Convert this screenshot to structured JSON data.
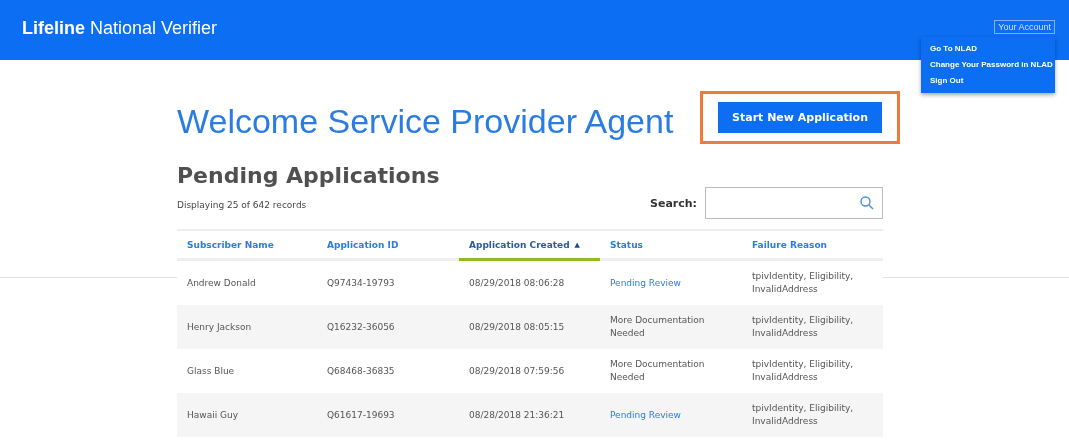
{
  "header": {
    "title": "**Lifeline** National Verifier",
    "account_button": "Your Account"
  },
  "account_menu": {
    "items": [
      {
        "label": "Go To NLAD"
      },
      {
        "label": "Change Your Password in NLAD"
      },
      {
        "label": "Sign Out"
      }
    ]
  },
  "welcome": "Welcome Service Provider Agent",
  "start_button": {
    "label": "Start New Application",
    "highlighted": true
  },
  "pending": {
    "title": "Pending Applications",
    "count_text": "Displaying 25 of 642 records",
    "search_label": "Search:"
  },
  "table": {
    "columns": [
      {
        "label": "Subscriber Name",
        "selected": false
      },
      {
        "label": "Application ID",
        "selected": false
      },
      {
        "label": "Application Created",
        "selected": true,
        "sort_mark": "▲"
      },
      {
        "label": "Status",
        "selected": false
      },
      {
        "label": "Failure Reason",
        "selected": false
      }
    ],
    "rows": [
      {
        "cells": [
          "Andrew Donald",
          "Q97434-19793",
          "08/29/2018 08:06:28"
        ],
        "status": {
          "kind": "link",
          "text": "Pending Review"
        },
        "failure": "tpivIdentity, Eligibility, InvalidAddress"
      },
      {
        "cells": [
          "Henry Jackson",
          "Q16232-36056",
          "08/29/2018 08:05:15"
        ],
        "status": {
          "kind": "text",
          "text": "More Documentation Needed"
        },
        "failure": "tpivIdentity, Eligibility, InvalidAddress"
      },
      {
        "cells": [
          "Glass Blue",
          "Q68468-36835",
          "08/29/2018 07:59:56"
        ],
        "status": {
          "kind": "text",
          "text": "More Documentation Needed"
        },
        "failure": "tpivIdentity, Eligibility, InvalidAddress"
      },
      {
        "cells": [
          "Hawaii Guy",
          "Q61617-19693",
          "08/28/2018 21:36:21"
        ],
        "status": {
          "kind": "link",
          "text": "Pending Review"
        },
        "failure": "tpivIdentity, Eligibility, InvalidAddress"
      }
    ]
  }
}
